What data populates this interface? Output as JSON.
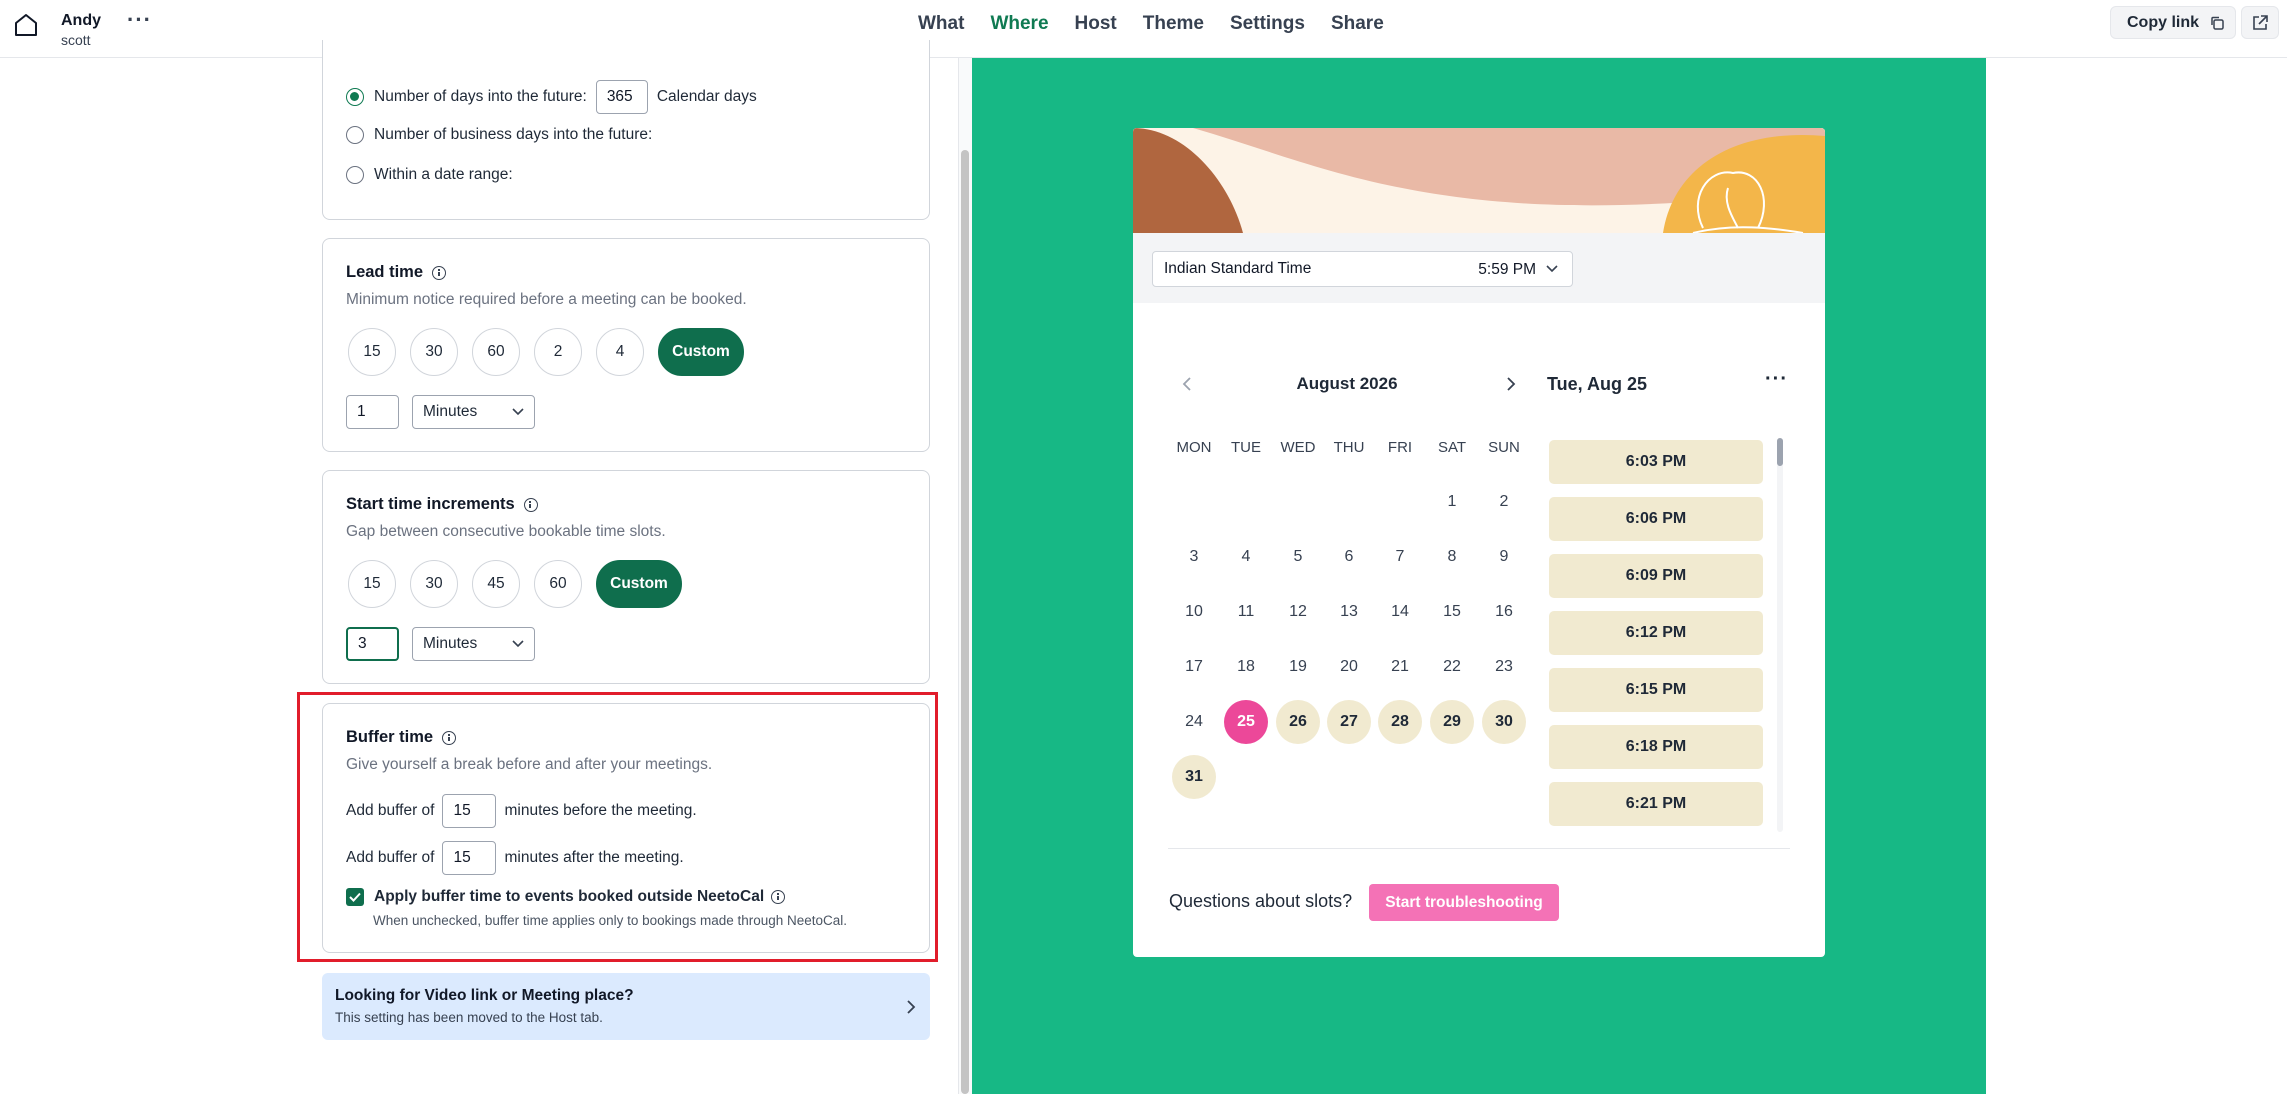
{
  "header": {
    "user_name": "Andy",
    "user_sub": "scott",
    "more": "···",
    "nav": [
      "What",
      "Where",
      "Host",
      "Theme",
      "Settings",
      "Share"
    ],
    "active_nav": "Where",
    "copy_link": "Copy link"
  },
  "window": {
    "opt_days_label": "Number of days into the future:",
    "opt_days_value": "365",
    "opt_days_unit": "Calendar days",
    "opt_business": "Number of business days into the future:",
    "opt_range": "Within a date range:"
  },
  "lead_time": {
    "title": "Lead time",
    "desc": "Minimum notice required before a meeting can be booked.",
    "pills": [
      "15",
      "30",
      "60",
      "2",
      "4",
      "Custom"
    ],
    "value": "1",
    "unit": "Minutes"
  },
  "increments": {
    "title": "Start time increments",
    "desc": "Gap between consecutive bookable time slots.",
    "pills": [
      "15",
      "30",
      "45",
      "60",
      "Custom"
    ],
    "value": "3",
    "unit": "Minutes"
  },
  "buffer": {
    "title": "Buffer time",
    "desc": "Give yourself a break before and after your meetings.",
    "prefix": "Add buffer of",
    "before_value": "15",
    "before_suffix": "minutes before the meeting.",
    "after_value": "15",
    "after_suffix": "minutes after the meeting.",
    "checkbox_label": "Apply buffer time to events booked outside NeetoCal",
    "checkbox_checked": true,
    "checkbox_help": "When unchecked, buffer time applies only to bookings made through NeetoCal."
  },
  "notice": {
    "title": "Looking for Video link or Meeting place?",
    "sub": "This setting has been moved to the Host tab."
  },
  "preview": {
    "timezone": "Indian Standard Time",
    "time": "5:59 PM",
    "month": "August 2026",
    "weekdays": [
      "MON",
      "TUE",
      "WED",
      "THU",
      "FRI",
      "SAT",
      "SUN"
    ],
    "days": [
      "1",
      "2",
      "3",
      "4",
      "5",
      "6",
      "7",
      "8",
      "9",
      "10",
      "11",
      "12",
      "13",
      "14",
      "15",
      "16",
      "17",
      "18",
      "19",
      "20",
      "21",
      "22",
      "23",
      "24",
      "25",
      "26",
      "27",
      "28",
      "29",
      "30",
      "31"
    ],
    "selected_day": "25",
    "available_days": [
      "25",
      "26",
      "27",
      "28",
      "29",
      "30",
      "31"
    ],
    "selected_date": "Tue, Aug 25",
    "more": "···",
    "slots": [
      "6:03 PM",
      "6:06 PM",
      "6:09 PM",
      "6:12 PM",
      "6:15 PM",
      "6:18 PM",
      "6:21 PM"
    ],
    "question": "Questions about slots?",
    "troubleshoot": "Start troubleshooting"
  },
  "colors": {
    "brand_green": "#0f6e4d",
    "preview_bg": "#17b885",
    "highlight": "#e11d2b",
    "accent_pink": "#ec4899"
  }
}
